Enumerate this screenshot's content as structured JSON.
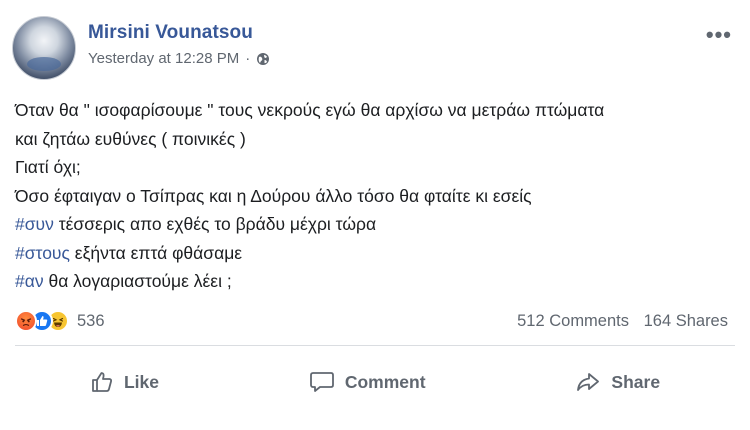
{
  "post": {
    "author": "Mirsini Vounatsou",
    "timestamp": "Yesterday at 12:28 PM",
    "separator": "·",
    "privacy_icon": "globe-icon",
    "more_icon": "•••",
    "lines": {
      "l1": "Όταν θα \" ισοφαρίσουμε \" τους νεκρούς εγώ θα αρχίσω να μετράω πτώματα",
      "l2": "και ζητάω ευθύνες ( ποινικές )",
      "l3": "Γιατί όχι;",
      "l4": "Όσο έφταιγαν ο Τσίπρας και η Δούρου άλλο τόσο θα φταίτε κι εσείς",
      "l5_tag": "#συν",
      "l5_text": " τέσσερις απο εχθές το βράδυ μέχρι τώρα",
      "l6_tag": "#στους",
      "l6_text": " εξήντα επτά φθάσαμε",
      "l7_tag": "#αν",
      "l7_text": " θα λογαριαστούμε λέει ;"
    },
    "reactions": {
      "types": [
        "angry",
        "like",
        "haha"
      ],
      "count": "536"
    },
    "comments_count": "512 Comments",
    "shares_count": "164 Shares",
    "actions": {
      "like": "Like",
      "comment": "Comment",
      "share": "Share"
    },
    "colors": {
      "name": "#385898",
      "hashtag": "#385898",
      "meta": "#606770",
      "like_blue": "#1877f2",
      "angry": "#f0452b",
      "haha": "#f7c531"
    }
  }
}
